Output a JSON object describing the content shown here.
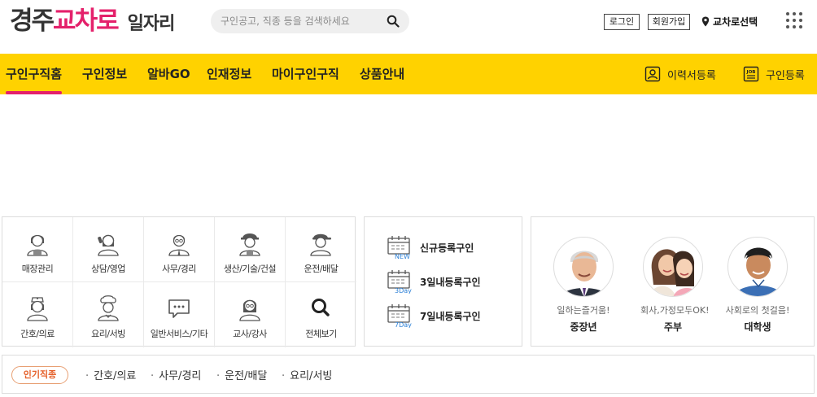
{
  "header": {
    "logo_part1": "경주",
    "logo_part2": "교차로",
    "logo_part3": "일자리",
    "search_placeholder": "구인공고, 직종 등을 검색하세요",
    "login": "로그인",
    "signup": "회원가입",
    "region": "교차로선택"
  },
  "nav": {
    "items": [
      "구인구직홈",
      "구인정보",
      "알바GO",
      "인재정보",
      "마이구인구직",
      "상품안내"
    ],
    "resume_register": "이력서등록",
    "job_register": "구인등록"
  },
  "categories": [
    {
      "label": "매장관리",
      "icon": "store-clerk-icon"
    },
    {
      "label": "상담/영업",
      "icon": "consultant-icon"
    },
    {
      "label": "사무/경리",
      "icon": "office-worker-icon"
    },
    {
      "label": "생산/기술/건설",
      "icon": "construction-worker-icon"
    },
    {
      "label": "운전/배달",
      "icon": "driver-icon"
    },
    {
      "label": "간호/의료",
      "icon": "nurse-icon"
    },
    {
      "label": "요리/서빙",
      "icon": "chef-icon"
    },
    {
      "label": "일반서비스/기타",
      "icon": "chat-icon"
    },
    {
      "label": "교사/강사",
      "icon": "teacher-icon"
    },
    {
      "label": "전체보기",
      "icon": "search-icon"
    }
  ],
  "registrations": [
    {
      "label": "신규등록구인",
      "tag": "NEW"
    },
    {
      "label": "3일내등록구인",
      "tag": "3Day"
    },
    {
      "label": "7일내등록구인",
      "tag": "7Day"
    }
  ],
  "personas": [
    {
      "subtitle": "일하는즐거움!",
      "name": "중장년"
    },
    {
      "subtitle": "회사,가정모두OK!",
      "name": "주부"
    },
    {
      "subtitle": "사회로의 첫걸음!",
      "name": "대학생"
    }
  ],
  "popular": {
    "badge": "인기직종",
    "keywords": [
      "간호/의료",
      "사무/경리",
      "운전/배달",
      "요리/서빙"
    ]
  },
  "colors": {
    "brand_pink": "#e4216b",
    "nav_yellow": "#ffd200",
    "calendar_blue": "#2a7fd6"
  }
}
